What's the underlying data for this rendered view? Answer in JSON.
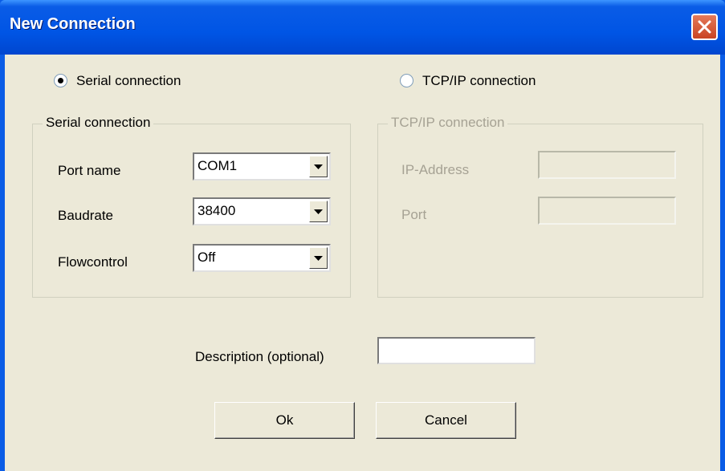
{
  "window": {
    "title": "New Connection"
  },
  "connection_type": {
    "serial_label": "Serial connection",
    "tcp_label": "TCP/IP connection",
    "selected": "serial"
  },
  "serial_group": {
    "legend": "Serial connection",
    "port_name_label": "Port name",
    "port_name_value": "COM1",
    "baudrate_label": "Baudrate",
    "baudrate_value": "38400",
    "flowcontrol_label": "Flowcontrol",
    "flowcontrol_value": "Off"
  },
  "tcp_group": {
    "legend": "TCP/IP connection",
    "ip_label": "IP-Address",
    "ip_value": "",
    "port_label": "Port",
    "port_value": ""
  },
  "description": {
    "label": "Description (optional)",
    "value": ""
  },
  "buttons": {
    "ok": "Ok",
    "cancel": "Cancel"
  },
  "colors": {
    "titlebar": "#0a5ce6",
    "dialog_bg": "#ece9d8",
    "disabled_text": "#a6a294"
  },
  "icons": {
    "close": "close-icon",
    "dropdown": "chevron-down-icon"
  }
}
